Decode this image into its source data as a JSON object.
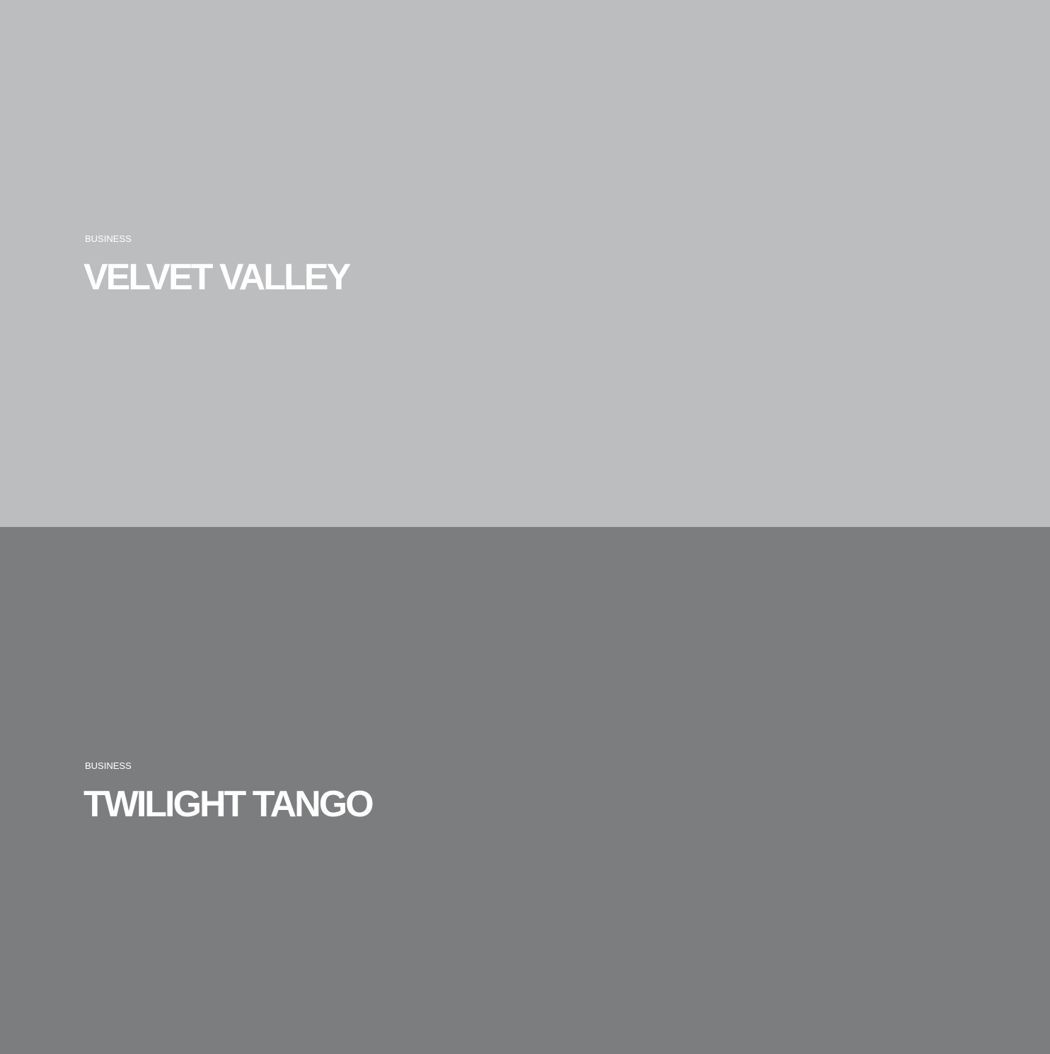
{
  "panels": [
    {
      "category": "BUSINESS",
      "title": "VELVET VALLEY",
      "background": "#bcbdbf"
    },
    {
      "category": "BUSINESS",
      "title": "TWILIGHT TANGO",
      "background": "#7c7d7f"
    }
  ],
  "text_color": "#ffffff"
}
